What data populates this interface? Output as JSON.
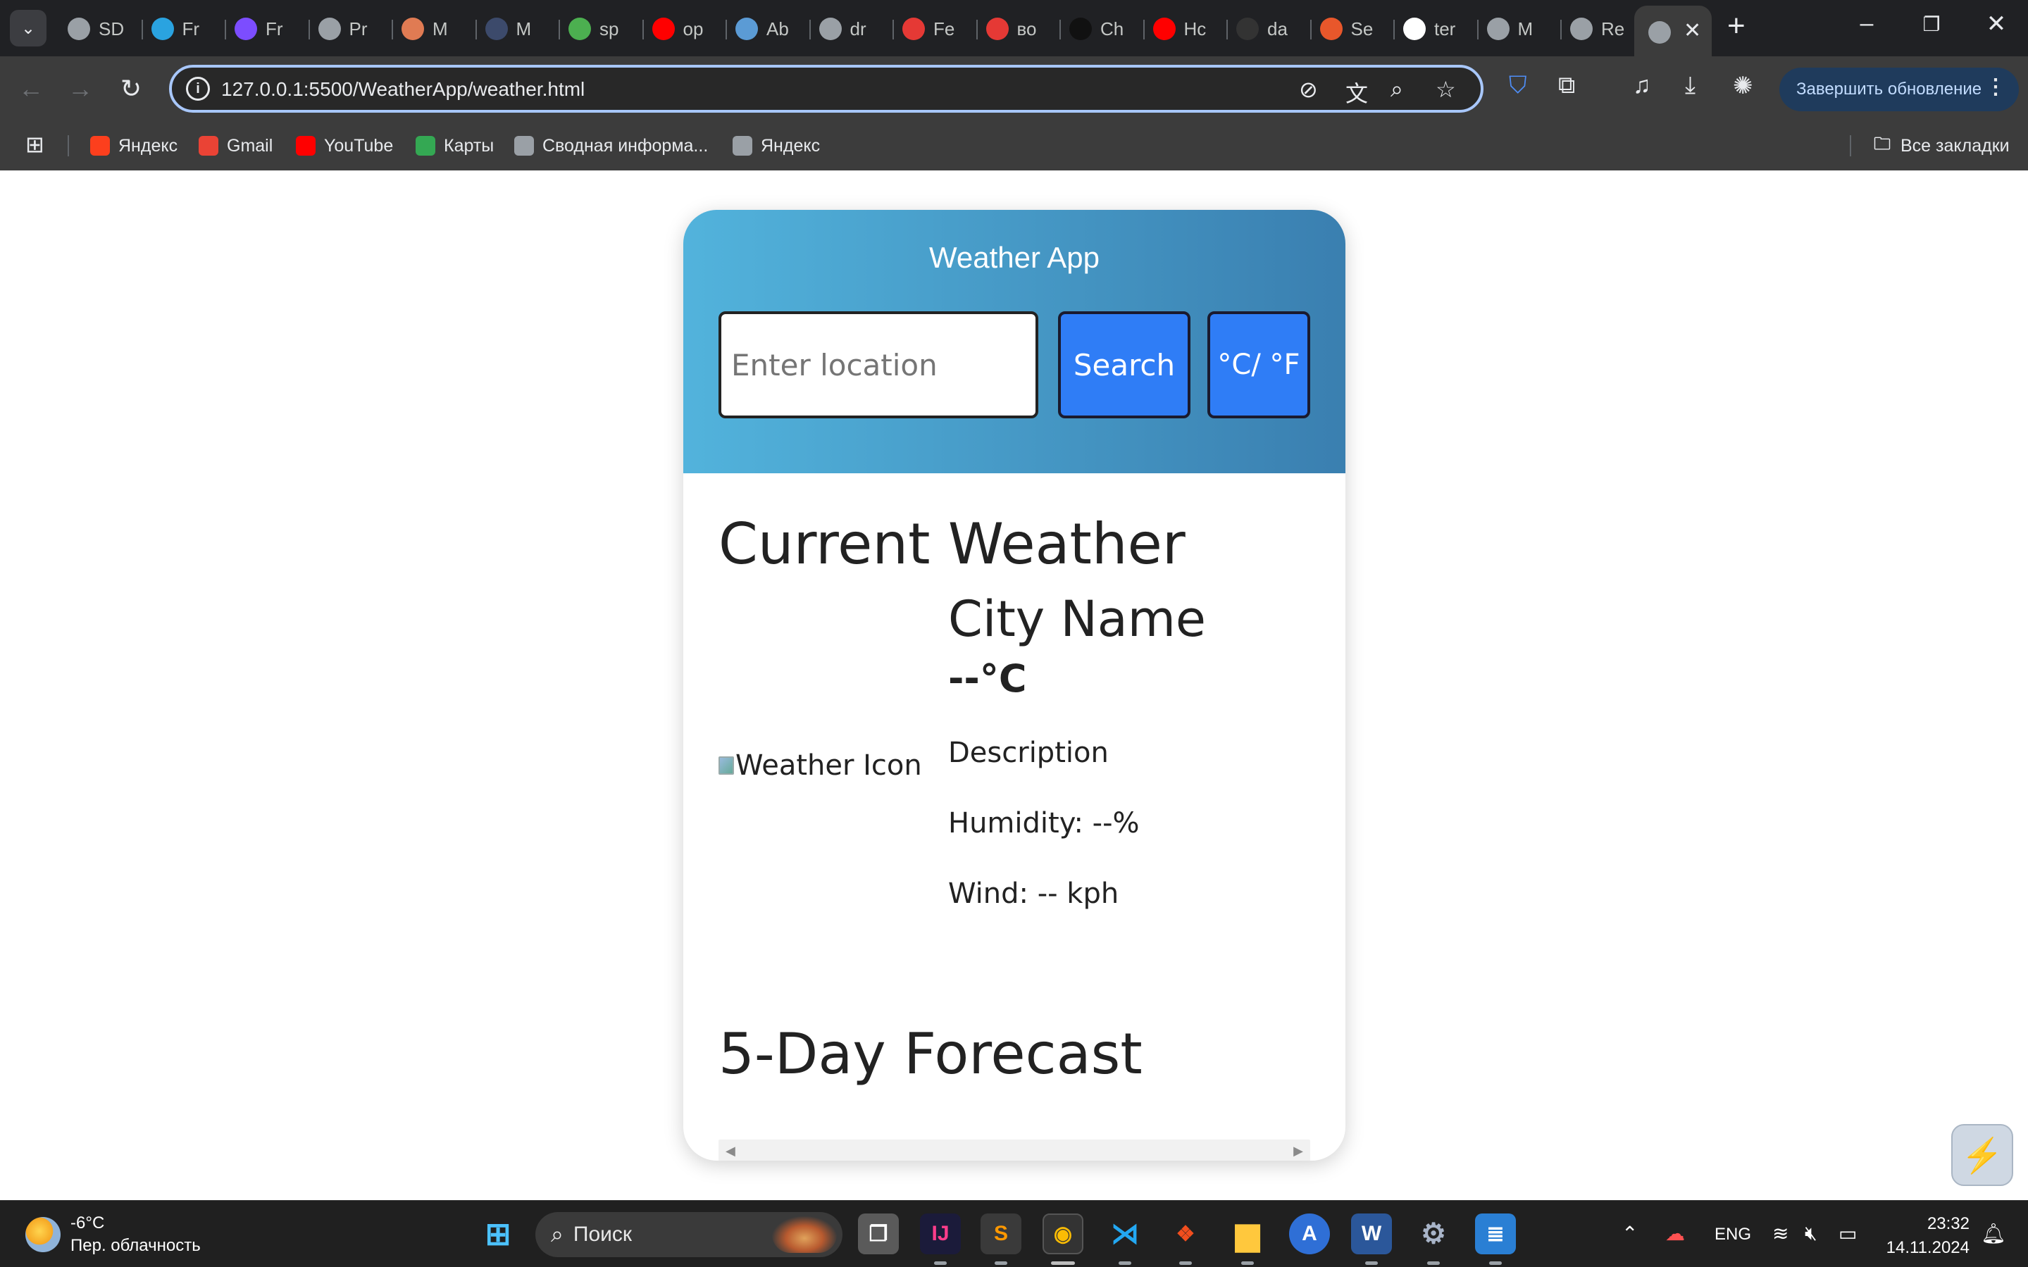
{
  "browser": {
    "tabs": [
      {
        "label": "SD",
        "icon": "globe-icon",
        "color": "#9aa0a6"
      },
      {
        "label": "Fr",
        "icon": "telegram-icon",
        "color": "#2aa3e0"
      },
      {
        "label": "Fr",
        "icon": "list-icon",
        "color": "#7c4dff"
      },
      {
        "label": "Pr",
        "icon": "globe-icon",
        "color": "#9aa0a6"
      },
      {
        "label": "M",
        "icon": "cap-icon",
        "color": "#e07b53"
      },
      {
        "label": "M",
        "icon": "pill-icon",
        "color": "#3c4a6b"
      },
      {
        "label": "sp",
        "icon": "sp-icon",
        "color": "#4caf50"
      },
      {
        "label": "op",
        "icon": "youtube-icon",
        "color": "#ff0000"
      },
      {
        "label": "Ab",
        "icon": "a-icon",
        "color": "#5b9bd5"
      },
      {
        "label": "dr",
        "icon": "globe-icon",
        "color": "#9aa0a6"
      },
      {
        "label": "Fe",
        "icon": "ab-icon",
        "color": "#e53935"
      },
      {
        "label": "во",
        "icon": "ab-icon",
        "color": "#e53935"
      },
      {
        "label": "Ch",
        "icon": "openai-icon",
        "color": "#111111"
      },
      {
        "label": "Hc",
        "icon": "youtube-icon",
        "color": "#ff0000"
      },
      {
        "label": "da",
        "icon": "github-icon",
        "color": "#333333"
      },
      {
        "label": "Se",
        "icon": "se-icon",
        "color": "#e8572b"
      },
      {
        "label": "ter",
        "icon": "google-icon",
        "color": "#ffffff"
      },
      {
        "label": "M",
        "icon": "globe-icon",
        "color": "#9aa0a6"
      },
      {
        "label": "Re",
        "icon": "globe-icon",
        "color": "#9aa0a6"
      }
    ],
    "active_tab_close": "✕",
    "new_tab": "+",
    "url": "127.0.0.1:5500/WeatherApp/weather.html",
    "update_button": "Завершить обновление",
    "bookmarks": [
      {
        "label": "Яндекс",
        "icon": "yandex-icon",
        "color": "#fc3f1d"
      },
      {
        "label": "Gmail",
        "icon": "gmail-icon",
        "color": "#ea4335"
      },
      {
        "label": "YouTube",
        "icon": "youtube-icon",
        "color": "#ff0000"
      },
      {
        "label": "Карты",
        "icon": "maps-pin-icon",
        "color": "#34a853"
      },
      {
        "label": "Сводная информа...",
        "icon": "sdu-icon",
        "color": "#9aa0a6"
      },
      {
        "label": "Яндекс",
        "icon": "globe-icon",
        "color": "#9aa0a6"
      }
    ],
    "all_bookmarks": "Все закладки"
  },
  "app": {
    "title": "Weather App",
    "location_placeholder": "Enter location",
    "search_label": "Search",
    "unit_toggle_label": "°C/ °F",
    "current_heading": "Current Weather",
    "icon_alt": "Weather Icon",
    "city_name": "City Name",
    "temperature": "--°C",
    "description": "Description",
    "humidity": "Humidity: --%",
    "wind": "Wind: -- kph",
    "forecast_heading": "5-Day Forecast"
  },
  "taskbar": {
    "weather_temp": "-6°C",
    "weather_desc": "Пер. облачность",
    "search_label": "Поиск",
    "language": "ENG",
    "time": "23:32",
    "date": "14.11.2024"
  }
}
